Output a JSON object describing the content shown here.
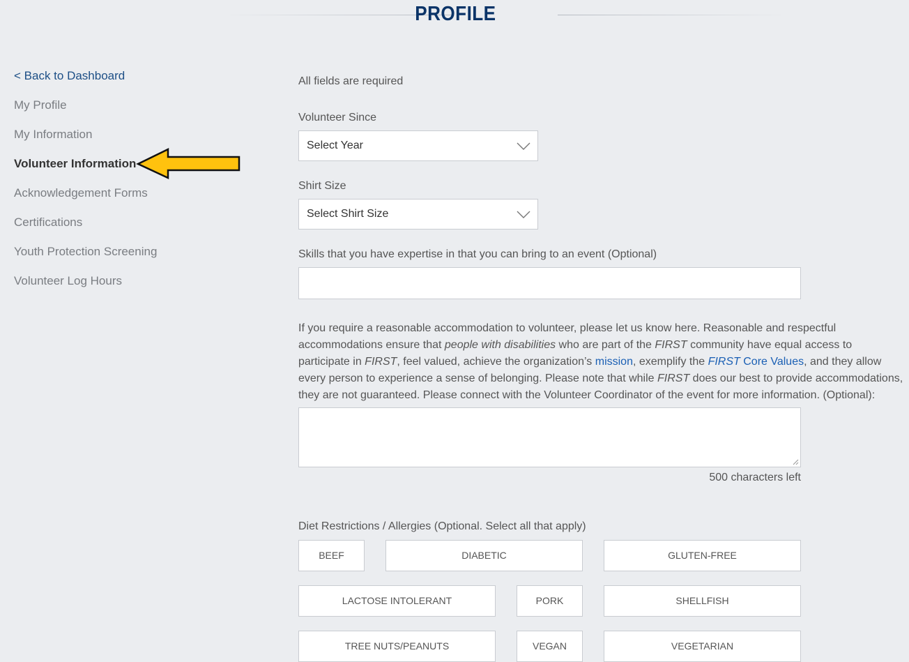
{
  "header": {
    "title": "PROFILE"
  },
  "sidebar": {
    "items": [
      {
        "label": "< Back to Dashboard"
      },
      {
        "label": "My Profile"
      },
      {
        "label": "My Information"
      },
      {
        "label": "Volunteer Information"
      },
      {
        "label": "Acknowledgement Forms"
      },
      {
        "label": "Certifications"
      },
      {
        "label": "Youth Protection Screening"
      },
      {
        "label": "Volunteer Log Hours"
      }
    ],
    "active_item": "Volunteer Information"
  },
  "colors": {
    "title": "#0b3468",
    "link": "#1a5fb4",
    "arrow_fill": "#ffc20e",
    "background": "#ebedf0"
  },
  "form": {
    "required_note": "All fields are required",
    "volunteer_since": {
      "label": "Volunteer Since",
      "value": "Select Year"
    },
    "shirt_size": {
      "label": "Shirt Size",
      "value": "Select Shirt Size"
    },
    "skills": {
      "label": "Skills that you have expertise in that you can bring to an event (Optional)",
      "value": ""
    },
    "accommodation": {
      "parts": [
        "If you require a reasonable accommodation to volunteer, please let us know here. Reasonable and respectful accommodations ensure that ",
        "people with disabilities",
        " who are part of the ",
        "FIRST",
        " community have equal access to participate in ",
        "FIRST",
        ", feel valued, achieve the organization’s ",
        "mission",
        ", exemplify the ",
        "FIRST",
        " Core Values",
        ", and they allow every person to experience a sense of belonging. Please note that while ",
        "FIRST",
        " does our best to provide accommodations, they are not guaranteed. Please connect with the Volunteer Coordinator of the event for more information. (Optional):"
      ],
      "value": "",
      "chars_left": "500 characters left"
    },
    "diet": {
      "label": "Diet Restrictions / Allergies (Optional. Select all that apply)",
      "options": [
        "BEEF",
        "DIABETIC",
        "GLUTEN-FREE",
        "LACTOSE INTOLERANT",
        "PORK",
        "SHELLFISH",
        "TREE NUTS/PEANUTS",
        "VEGAN",
        "VEGETARIAN"
      ]
    }
  }
}
